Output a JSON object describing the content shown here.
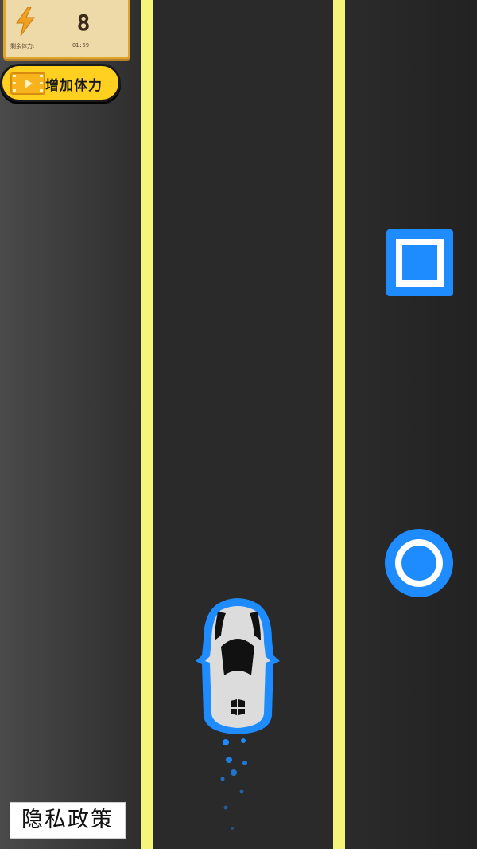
{
  "hud": {
    "energy_icon": "lightning-bolt-icon",
    "energy_count": "8",
    "energy_sub_label": "剩余体力:",
    "energy_timer": "01:59",
    "add_stamina_icon": "video-play-icon",
    "add_stamina_label": "增加体力"
  },
  "game": {
    "lanes": 2,
    "obstacles": [
      {
        "shape": "square",
        "color": "#1e8cff"
      },
      {
        "shape": "circle",
        "color": "#1e8cff"
      }
    ],
    "player_icon": "race-car-icon",
    "player_outline_color": "#1e8cff",
    "lane_line_color": "#f7f47a"
  },
  "footer": {
    "privacy_label": "隐私政策"
  }
}
